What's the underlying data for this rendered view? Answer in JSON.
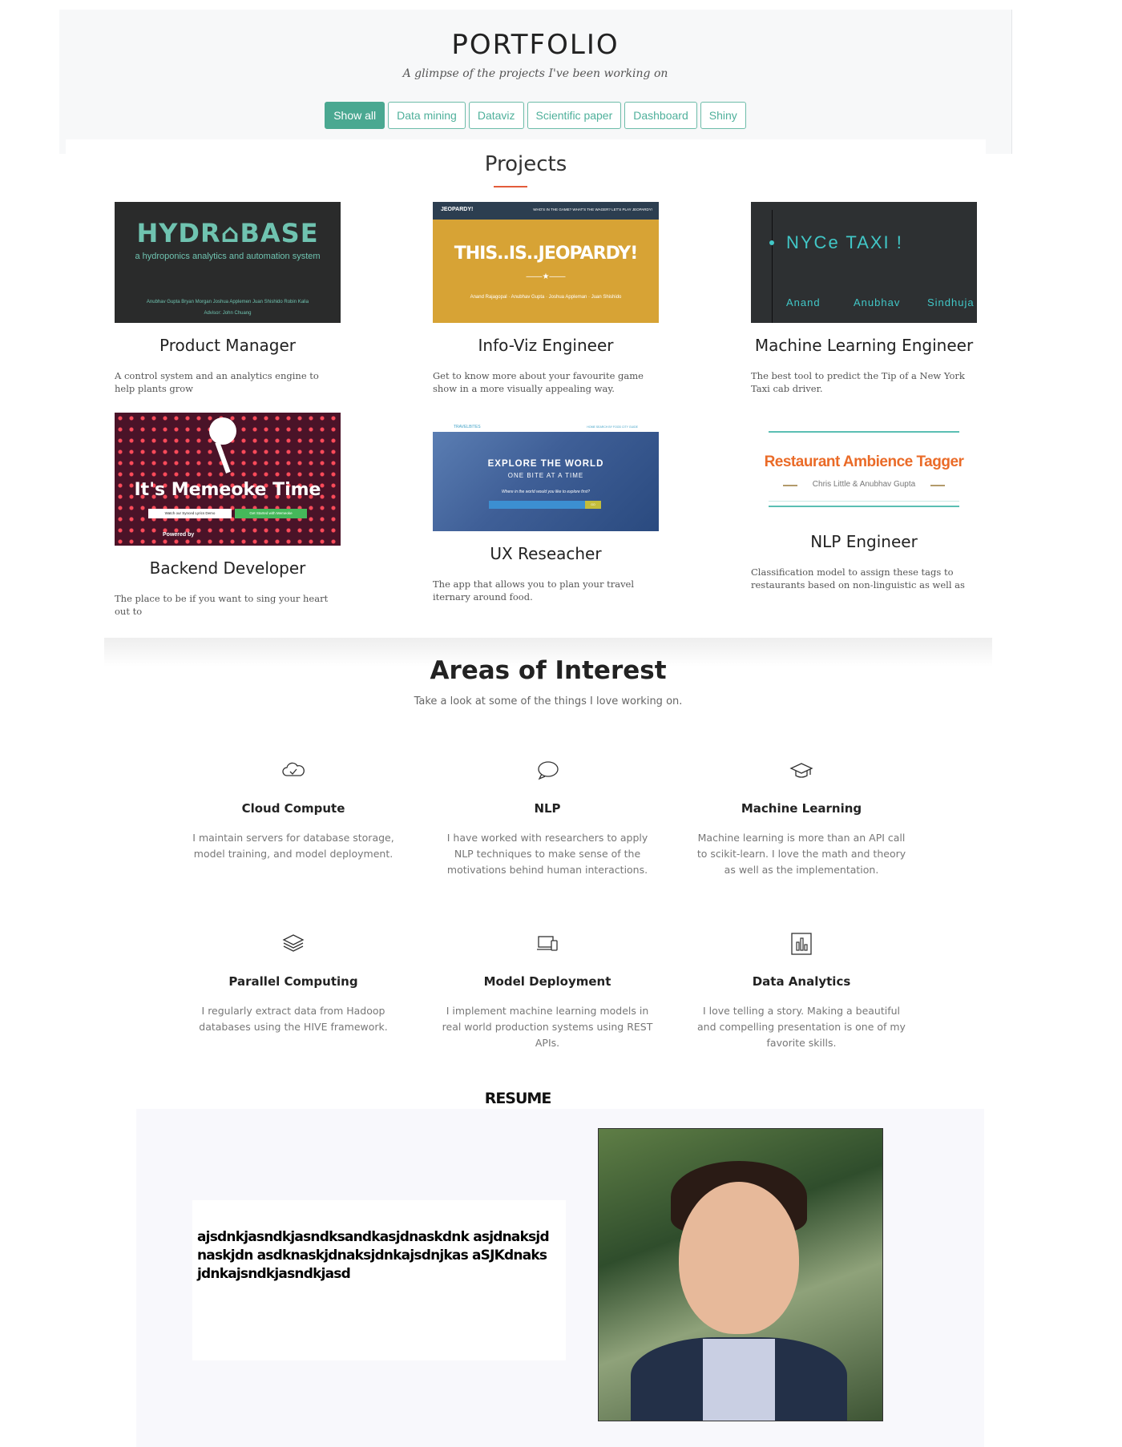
{
  "portfolio": {
    "title": "PORTFOLIO",
    "subtitle": "A glimpse of the projects I've been working on",
    "filters": [
      "Show all",
      "Data mining",
      "Dataviz",
      "Scientific paper",
      "Dashboard",
      "Shiny"
    ],
    "active_filter": "Show all"
  },
  "projects": {
    "heading": "Projects",
    "items": [
      {
        "role": "Product Manager",
        "description": "A control system and an analytics engine to help plants grow",
        "thumb": {
          "logo": "HYDR⌂BASE",
          "tagline": "a hydroponics analytics and automation system",
          "names": "Anubhav Gupta   Bryan Morgan   Joshua Applemen   Juan Shishido   Robin Kalia",
          "advisor": "Advisor: John Chuang"
        }
      },
      {
        "role": "Info-Viz Engineer",
        "description": "Get to know more about your favourite game show in a more visually appealing way.",
        "thumb": {
          "brand": "JEOPARDY!",
          "nav": "WHO'S IN THE GAME?   WHAT'S THE WAGER?   LET'S PLAY JEOPARDY!",
          "headline": "THIS..IS..JEOPARDY!",
          "credits": "Anand Rajagopal · Anubhav Gupta · Joshua Appleman · Juan Shishido"
        }
      },
      {
        "role": "Machine Learning Engineer",
        "description": "The best tool to predict the Tip of a New York Taxi cab driver.",
        "thumb": {
          "title": "NYCe TAXI !",
          "names": [
            "Anand",
            "Anubhav",
            "Sindhuja"
          ]
        }
      },
      {
        "role": "Backend Developer",
        "description": "The place to be if you want to sing your heart out to",
        "thumb": {
          "title": "It's Memeoke Time",
          "button1": "Watch our Synced Lyrics Demo",
          "button2": "Get Started with Memeoke",
          "powered": "Powered by"
        }
      },
      {
        "role": "UX Reseacher",
        "description": "The app that allows you to plan your travel iternary around food.",
        "thumb": {
          "brand": "TRAVELBITES",
          "nav": "HOME   SEARCH BY FOOD   CITY GUIDE",
          "line1": "EXPLORE THE WORLD",
          "line2": "ONE BITE AT A TIME",
          "question": "Where in the world would you like to explore first?",
          "go": "GO"
        }
      },
      {
        "role": "NLP Engineer",
        "description": "Classification model to assign these tags to restaurants based on non-linguistic as well as",
        "thumb": {
          "title": "Restaurant Ambience Tagger",
          "authors": "Chris Little & Anubhav Gupta"
        }
      }
    ]
  },
  "areas": {
    "title": "Areas of Interest",
    "subtitle": "Take a look at some of the things I love working on.",
    "items": [
      {
        "name": "Cloud Compute",
        "text": "I maintain servers for database storage, model training, and model deployment.",
        "icon": "cloud-icon"
      },
      {
        "name": "NLP",
        "text": "I have worked with researchers to apply NLP techniques to make sense of the motivations behind human interactions.",
        "icon": "speech-bubble-icon"
      },
      {
        "name": "Machine Learning",
        "text": "Machine learning is more than an API call to scikit-learn. I love the math and theory as well as the implementation.",
        "icon": "graduation-cap-icon"
      },
      {
        "name": "Parallel Computing",
        "text": "I regularly extract data from Hadoop databases using the HIVE framework.",
        "icon": "layers-icon"
      },
      {
        "name": "Model Deployment",
        "text": "I implement machine learning models in real world production systems using REST APIs.",
        "icon": "devices-icon"
      },
      {
        "name": "Data Analytics",
        "text": "I love telling a story. Making a beautiful and compelling presentation is one of my favorite skills.",
        "icon": "bar-chart-icon"
      }
    ]
  },
  "resume": {
    "label": "RESUME",
    "text": "ajsdnkjasndkjasndksandkasjdnaskdnk asjdnaksjdnaskjdn asdknaskjdnaksjdnkajsdnjkas aSJKdnaksjdnkajsndkjasndkjasd"
  },
  "colors": {
    "accent": "#4aa891",
    "projects_underline": "#e35b3b"
  }
}
